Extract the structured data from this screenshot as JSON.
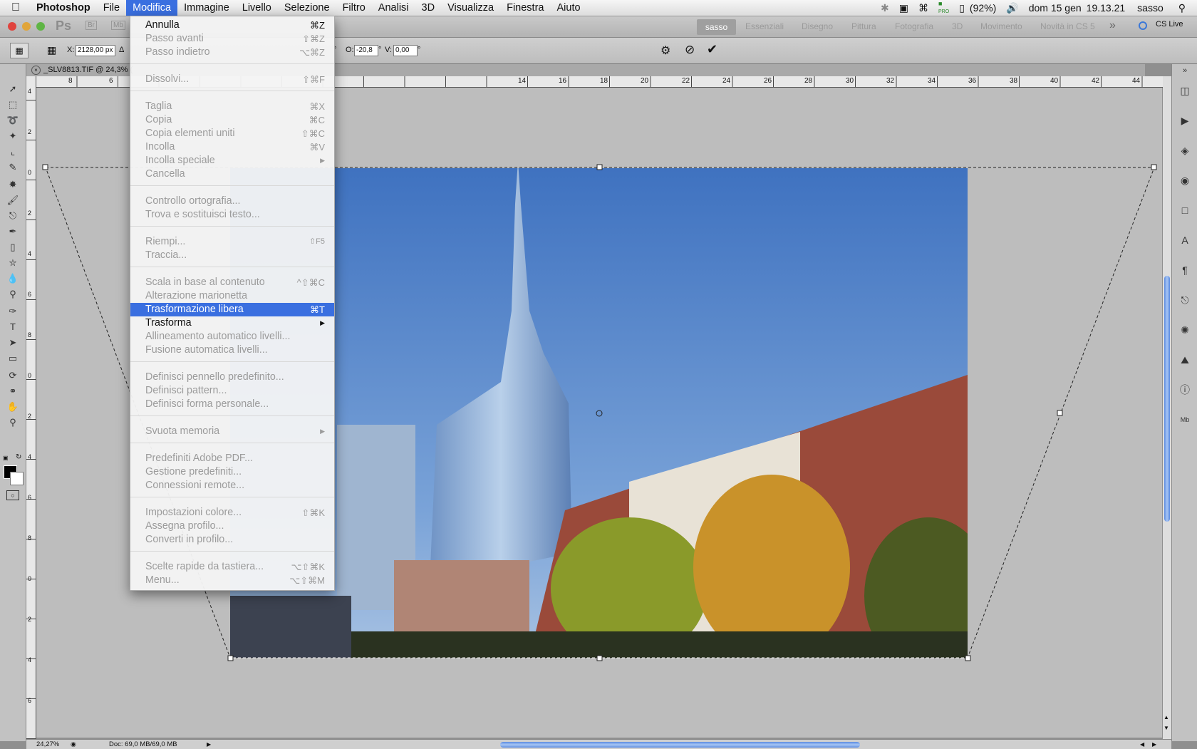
{
  "menubar": {
    "app_name": "Photoshop",
    "items": [
      "File",
      "Modifica",
      "Immagine",
      "Livello",
      "Selezione",
      "Filtro",
      "Analisi",
      "3D",
      "Visualizza",
      "Finestra",
      "Aiuto"
    ],
    "active_item": "Modifica",
    "status": {
      "battery": "(92%)",
      "date": "dom 15 gen",
      "time": "19.13.21",
      "user": "sasso",
      "flag_badge": "PRO"
    }
  },
  "appbar": {
    "workspace_active": "sasso",
    "workspaces": [
      "Essenziali",
      "Disegno",
      "Pittura",
      "Fotografia",
      "3D",
      "Movimento",
      "Novità in CS 5"
    ],
    "cs_live": "CS Live"
  },
  "options": {
    "x_label": "X:",
    "x_value": "2128,00 px",
    "o_label": "O:",
    "o_value": "-20,8",
    "v_label": "V:",
    "v_value": "0,00",
    "degree": "°"
  },
  "document": {
    "tab_title": "_SLV8813.TIF @ 24,3% (",
    "zoom": "24,27%",
    "doc_size": "Doc: 69,0 MB/69,0 MB"
  },
  "ruler": {
    "h_ticks": [
      "8",
      "6",
      "14",
      "16",
      "18",
      "20",
      "22",
      "24",
      "26",
      "28",
      "30",
      "32",
      "34",
      "36",
      "38",
      "40",
      "42",
      "44"
    ],
    "v_ticks": [
      "4",
      "2",
      "0",
      "2",
      "4",
      "6",
      "8",
      "0",
      "2",
      "4",
      "6",
      "8",
      "0",
      "2",
      "4",
      "6"
    ]
  },
  "menu": {
    "items": [
      {
        "label": "Annulla",
        "shortcut": "⌘Z",
        "enabled": true
      },
      {
        "label": "Passo avanti",
        "shortcut": "⇧⌘Z",
        "enabled": false
      },
      {
        "label": "Passo indietro",
        "shortcut": "⌥⌘Z",
        "enabled": false
      },
      {
        "label": "Dissolvi...",
        "shortcut": "⇧⌘F",
        "enabled": false
      },
      {
        "label": "Taglia",
        "shortcut": "⌘X",
        "enabled": false
      },
      {
        "label": "Copia",
        "shortcut": "⌘C",
        "enabled": false
      },
      {
        "label": "Copia elementi uniti",
        "shortcut": "⇧⌘C",
        "enabled": false
      },
      {
        "label": "Incolla",
        "shortcut": "⌘V",
        "enabled": false
      },
      {
        "label": "Incolla speciale",
        "shortcut": "▶",
        "enabled": false
      },
      {
        "label": "Cancella",
        "shortcut": "",
        "enabled": false
      },
      {
        "label": "Controllo ortografia...",
        "shortcut": "",
        "enabled": false
      },
      {
        "label": "Trova e sostituisci testo...",
        "shortcut": "",
        "enabled": false
      },
      {
        "label": "Riempi...",
        "shortcut": "⇧F5",
        "enabled": false
      },
      {
        "label": "Traccia...",
        "shortcut": "",
        "enabled": false
      },
      {
        "label": "Scala in base al contenuto",
        "shortcut": "^⇧⌘C",
        "enabled": false
      },
      {
        "label": "Alterazione marionetta",
        "shortcut": "",
        "enabled": false
      },
      {
        "label": "Trasformazione libera",
        "shortcut": "⌘T",
        "enabled": true,
        "highlighted": true
      },
      {
        "label": "Trasforma",
        "shortcut": "▶",
        "enabled": true
      },
      {
        "label": "Allineamento automatico livelli...",
        "shortcut": "",
        "enabled": false
      },
      {
        "label": "Fusione automatica livelli...",
        "shortcut": "",
        "enabled": false
      },
      {
        "label": "Definisci pennello predefinito...",
        "shortcut": "",
        "enabled": false
      },
      {
        "label": "Definisci pattern...",
        "shortcut": "",
        "enabled": false
      },
      {
        "label": "Definisci forma personale...",
        "shortcut": "",
        "enabled": false
      },
      {
        "label": "Svuota memoria",
        "shortcut": "▶",
        "enabled": false
      },
      {
        "label": "Predefiniti Adobe PDF...",
        "shortcut": "",
        "enabled": false
      },
      {
        "label": "Gestione predefiniti...",
        "shortcut": "",
        "enabled": false
      },
      {
        "label": "Connessioni remote...",
        "shortcut": "",
        "enabled": false
      },
      {
        "label": "Impostazioni colore...",
        "shortcut": "⇧⌘K",
        "enabled": false
      },
      {
        "label": "Assegna profilo...",
        "shortcut": "",
        "enabled": false
      },
      {
        "label": "Converti in profilo...",
        "shortcut": "",
        "enabled": false
      },
      {
        "label": "Scelte rapide da tastiera...",
        "shortcut": "⌥⇧⌘K",
        "enabled": false
      },
      {
        "label": "Menu...",
        "shortcut": "⌥⇧⌘M",
        "enabled": false
      }
    ]
  },
  "colors": {
    "accent": "#3a6fe0",
    "sky": "#4f80c8"
  }
}
